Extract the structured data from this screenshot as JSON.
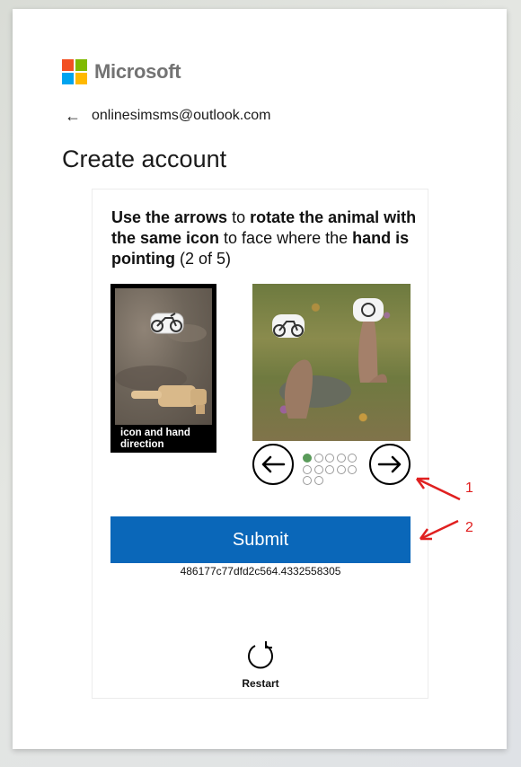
{
  "brand": {
    "name": "Microsoft",
    "colors": [
      "#f25022",
      "#7fba00",
      "#00a4ef",
      "#ffb900"
    ]
  },
  "account": {
    "email": "onlinesimsms@outlook.com",
    "back_icon": "back-arrow-icon"
  },
  "page": {
    "title": "Create account"
  },
  "puzzle": {
    "instruction": {
      "p1": "Use the arrows",
      "p2": " to ",
      "p3": "rotate the animal with the same icon",
      "p4": " to face where the ",
      "p5": "hand is pointing",
      "p6": " (2 of 5)"
    },
    "reference_caption": "icon and hand direction",
    "progress": {
      "total_dots": 12,
      "current_index": 0
    },
    "accent_color": "#5a9b5a",
    "left_arrow_icon": "arrow-left-icon",
    "right_arrow_icon": "arrow-right-icon",
    "submit_label": "Submit",
    "submit_color": "#0a67b9",
    "session_id": "486177c77dfd2c564.4332558305",
    "restart_label": "Restart",
    "restart_icon": "restart-icon"
  },
  "annotations": {
    "label_1": "1",
    "label_2": "2",
    "color": "#e02020"
  }
}
